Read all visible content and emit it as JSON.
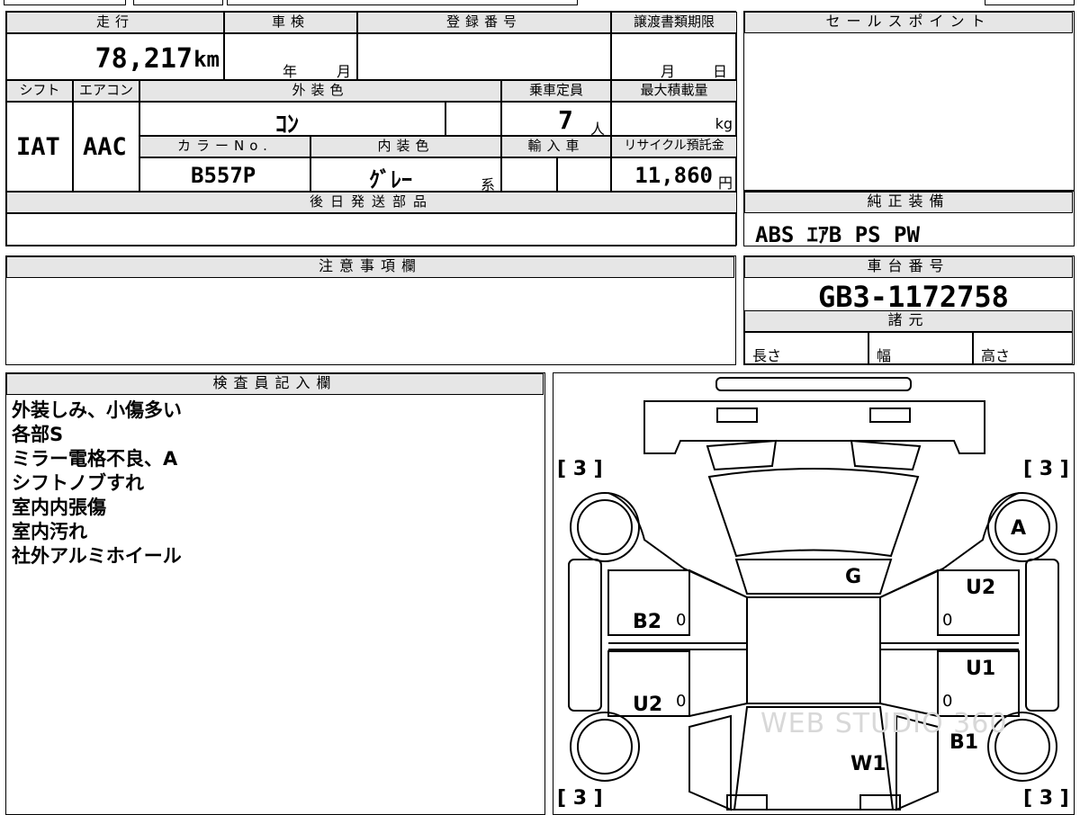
{
  "specs": {
    "mileage": {
      "label": "走行",
      "value": "78,217",
      "unit": "km"
    },
    "inspection": {
      "label": "車検",
      "year_unit": "年",
      "month_unit": "月"
    },
    "registration": {
      "label": "登録番号"
    },
    "transfer_deadline": {
      "label": "譲渡書類期限",
      "month_unit": "月",
      "day_unit": "日"
    },
    "shift": {
      "label": "シフト",
      "value": "IAT"
    },
    "aircon": {
      "label": "エアコン",
      "value": "AAC"
    },
    "exterior_color": {
      "label": "外装色",
      "value": "ｺﾝ"
    },
    "capacity": {
      "label": "乗車定員",
      "value": "7",
      "unit": "人"
    },
    "max_load": {
      "label": "最大積載量",
      "unit": "kg"
    },
    "color_no": {
      "label": "カラーNo.",
      "value": "B557P"
    },
    "interior_color": {
      "label": "内装色",
      "value": "ｸﾞﾚｰ",
      "suffix": "系"
    },
    "import": {
      "label": "輸入車"
    },
    "recycle": {
      "label": "リサイクル預託金",
      "value": "11,860",
      "unit": "円"
    }
  },
  "sales_point": {
    "label": "セールスポイント"
  },
  "later_parts": {
    "label": "後日発送部品"
  },
  "equipment": {
    "label": "純正装備",
    "value": "ABS ｴｱB PS PW"
  },
  "notes": {
    "label": "注意事項欄"
  },
  "chassis": {
    "label": "車台番号",
    "value": "GB3-1172758"
  },
  "dimensions": {
    "label": "諸元",
    "length": "長さ",
    "width": "幅",
    "height": "高さ"
  },
  "inspector": {
    "label": "検査員記入欄",
    "lines": [
      "外装しみ、小傷多い",
      "各部S",
      "ミラー電格不良、A",
      "シフトノブすれ",
      "室内内張傷",
      "室内汚れ",
      "社外アルミホイール"
    ]
  },
  "diagram": {
    "tire_tl": "[ 3 ]",
    "tire_tr": "[ 3 ]",
    "tire_bl": "[ 3 ]",
    "tire_br": "[ 3 ]",
    "mark_A": "A",
    "mark_G": "G",
    "mark_U2_right": "U2",
    "mark_B2": "B2",
    "mark_U1": "U1",
    "mark_U2_left": "U2",
    "mark_B1": "B1",
    "mark_W1": "W1",
    "zero": "0",
    "watermark": "WEB STUDIO 360"
  }
}
